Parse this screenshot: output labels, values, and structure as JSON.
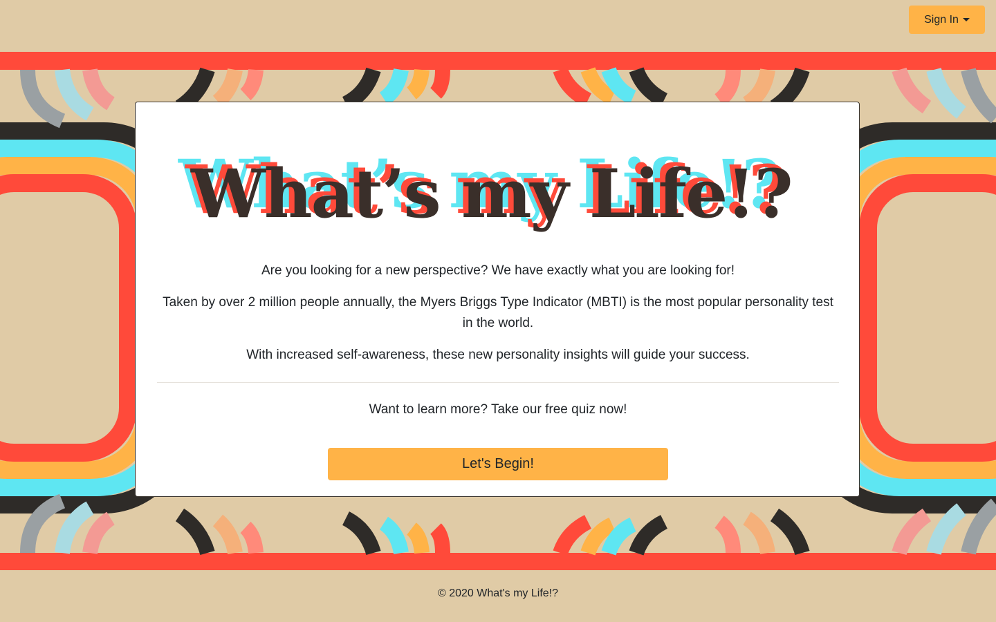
{
  "nav": {
    "signin_label": "Sign In"
  },
  "card": {
    "logo_text": "What’s my Life!?",
    "p1": "Are you looking for a new perspective? We have exactly what you are looking for!",
    "p2": "Taken by over 2 million people annually, the Myers Briggs Type Indicator (MBTI) is the most popular personality test in the world.",
    "p3": "With increased self-awareness, these new personality insights will guide your success.",
    "p4": "Want to learn more? Take our free quiz now!",
    "cta_label": "Let's Begin!"
  },
  "footer": {
    "copyright": "© 2020 What's my Life!?"
  },
  "colors": {
    "background": "#e0cba6",
    "accent_orange": "#ffb347",
    "stripe_red": "#ff4a3a",
    "stripe_cyan": "#5ee6f2",
    "stripe_dark": "#2e2b28",
    "logo_dark": "#3a2f2a"
  },
  "icons": [
    "chevron-down-icon"
  ]
}
